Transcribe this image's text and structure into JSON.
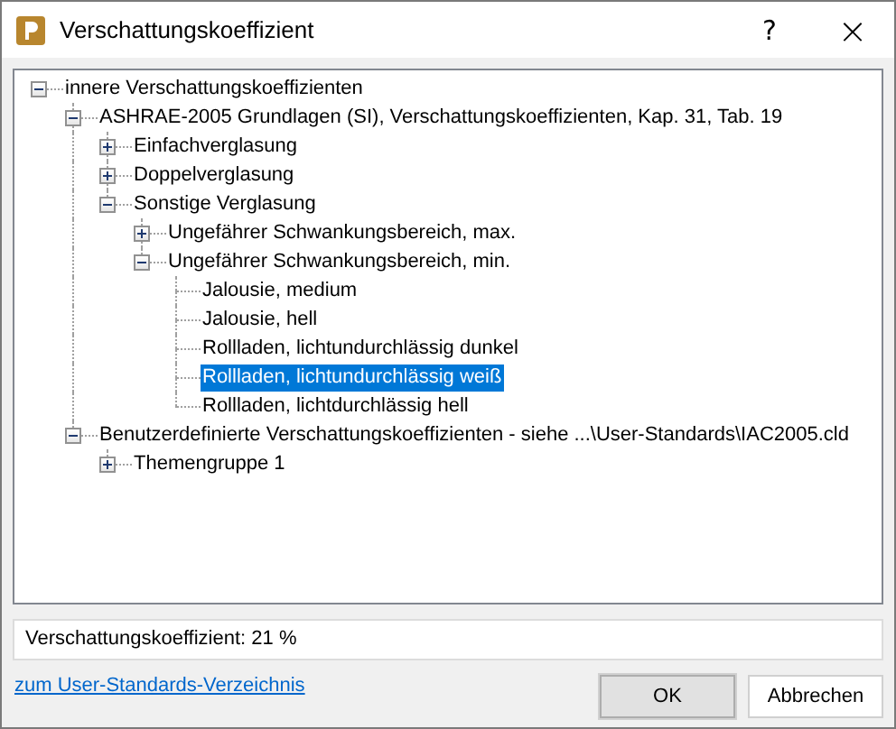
{
  "window": {
    "title": "Verschattungskoeffizient",
    "help": "?",
    "close": "×"
  },
  "tree": [
    {
      "label": "innere Verschattungskoeffizienten",
      "expanded": true,
      "selected": false,
      "children": [
        {
          "label": "ASHRAE-2005 Grundlagen (SI), Verschattungskoeffizienten, Kap. 31, Tab. 19",
          "expanded": true,
          "selected": false,
          "children": [
            {
              "label": "Einfachverglasung",
              "expanded": false,
              "selected": false
            },
            {
              "label": "Doppelverglasung",
              "expanded": false,
              "selected": false
            },
            {
              "label": "Sonstige Verglasung",
              "expanded": true,
              "selected": false,
              "children": [
                {
                  "label": "Ungefährer Schwankungsbereich, max.",
                  "expanded": false,
                  "selected": false
                },
                {
                  "label": "Ungefährer Schwankungsbereich, min.",
                  "expanded": true,
                  "selected": false,
                  "children": [
                    {
                      "label": "Jalousie, medium",
                      "selected": false
                    },
                    {
                      "label": "Jalousie, hell",
                      "selected": false
                    },
                    {
                      "label": "Rollladen, lichtundurchlässig dunkel",
                      "selected": false
                    },
                    {
                      "label": "Rollladen, lichtundurchlässig weiß",
                      "selected": true
                    },
                    {
                      "label": "Rollladen, lichtdurchlässig hell",
                      "selected": false
                    }
                  ]
                }
              ]
            }
          ]
        },
        {
          "label": "Benutzerdefinierte Verschattungskoeffizienten - siehe ...\\User-Standards\\IAC2005.cld",
          "expanded": true,
          "selected": false,
          "children": [
            {
              "label": "Themengruppe 1",
              "expanded": false,
              "selected": false
            }
          ]
        }
      ]
    }
  ],
  "status": "Verschattungskoeffizient: 21 %",
  "link": "zum User-Standards-Verzeichnis",
  "buttons": [
    {
      "label": "OK",
      "default": true
    },
    {
      "label": "Abbrechen",
      "default": false
    }
  ]
}
